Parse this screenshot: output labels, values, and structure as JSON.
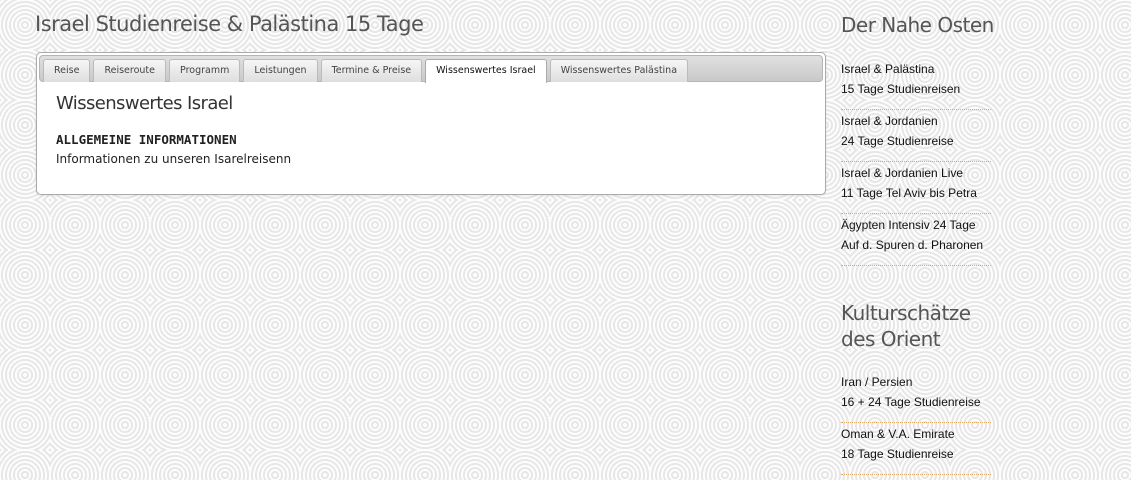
{
  "page": {
    "title": "Israel Studienreise & Palästina 15 Tage"
  },
  "tabs": [
    {
      "label": "Reise"
    },
    {
      "label": "Reiseroute"
    },
    {
      "label": "Programm"
    },
    {
      "label": "Leistungen"
    },
    {
      "label": "Termine & Preise"
    },
    {
      "label": "Wissenswertes Israel",
      "active": true
    },
    {
      "label": "Wissenswertes Palästina"
    }
  ],
  "panel": {
    "heading": "Wissenswertes Israel",
    "section_heading": "ALLGEMEINE INFORMATIONEN",
    "section_text": "Informationen zu unseren Isarelreisenn"
  },
  "sidebar": {
    "section1": {
      "title": "Der Nahe Osten",
      "links": [
        {
          "line1": "Israel & Palästina",
          "line2": "15 Tage Studienreisen"
        },
        {
          "line1": "Israel & Jordanien",
          "line2": "24 Tage Studienreise"
        },
        {
          "line1": "Israel & Jordanien Live",
          "line2": "11 Tage Tel Aviv bis Petra"
        },
        {
          "line1": "Ägypten Intensiv 24 Tage",
          "line2": "Auf d. Spuren d. Pharonen"
        }
      ]
    },
    "section2": {
      "title_line1": "Kulturschätze",
      "title_line2": "des Orient",
      "links": [
        {
          "line1": "Iran / Persien",
          "line2": "16 + 24 Tage Studienreise"
        },
        {
          "line1": "Oman & V.A. Emirate",
          "line2": "18 Tage Studienreise"
        }
      ]
    }
  },
  "colors": {
    "background": "#f3f3f3",
    "panel": "#ffffff",
    "divider": "#e0a860",
    "title_text": "#555555"
  }
}
